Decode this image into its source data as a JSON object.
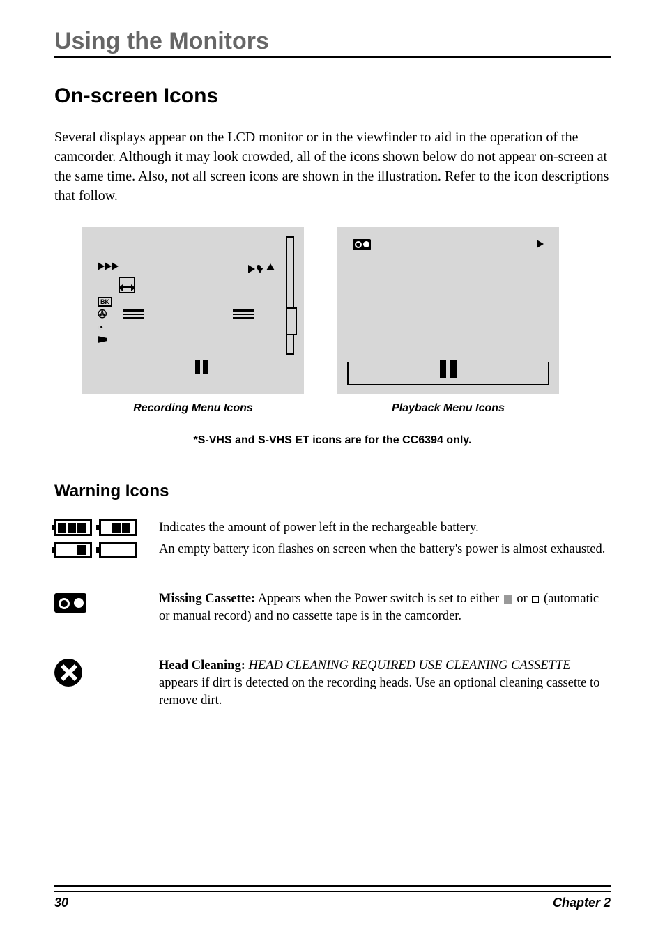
{
  "section_title": "Using the Monitors",
  "h2": "On-screen Icons",
  "intro": "Several displays appear on the LCD monitor or in the viewfinder to aid in the operation of the camcorder. Although it may look crowded, all of the icons shown below do not appear on-screen at the same time. Also, not all screen icons are shown in the illustration. Refer to the icon descriptions that follow.",
  "caption_left": "Recording Menu Icons",
  "caption_right": "Playback Menu Icons",
  "note": "*S-VHS and S-VHS ET icons are for the CC6394 only.",
  "h3": "Warning Icons",
  "battery": {
    "line1": "Indicates the amount of power left in the rechargeable battery.",
    "line2": "An empty battery icon flashes on screen when the battery's power is almost exhausted."
  },
  "missing_cassette": {
    "label": "Missing Cassette:",
    "text_a": " Appears when the Power switch is set to either ",
    "text_b": " or ",
    "text_c": " (automatic or manual record) and no cassette tape is in the camcorder."
  },
  "head_cleaning": {
    "label": "Head Cleaning:",
    "italic": " HEAD CLEANING REQUIRED USE CLEANING CASSETTE",
    "rest": " appears if dirt is detected on the recording heads. Use an optional cleaning cassette to remove dirt."
  },
  "bk_label": "BK",
  "footer": {
    "page": "30",
    "chapter": "Chapter 2"
  }
}
